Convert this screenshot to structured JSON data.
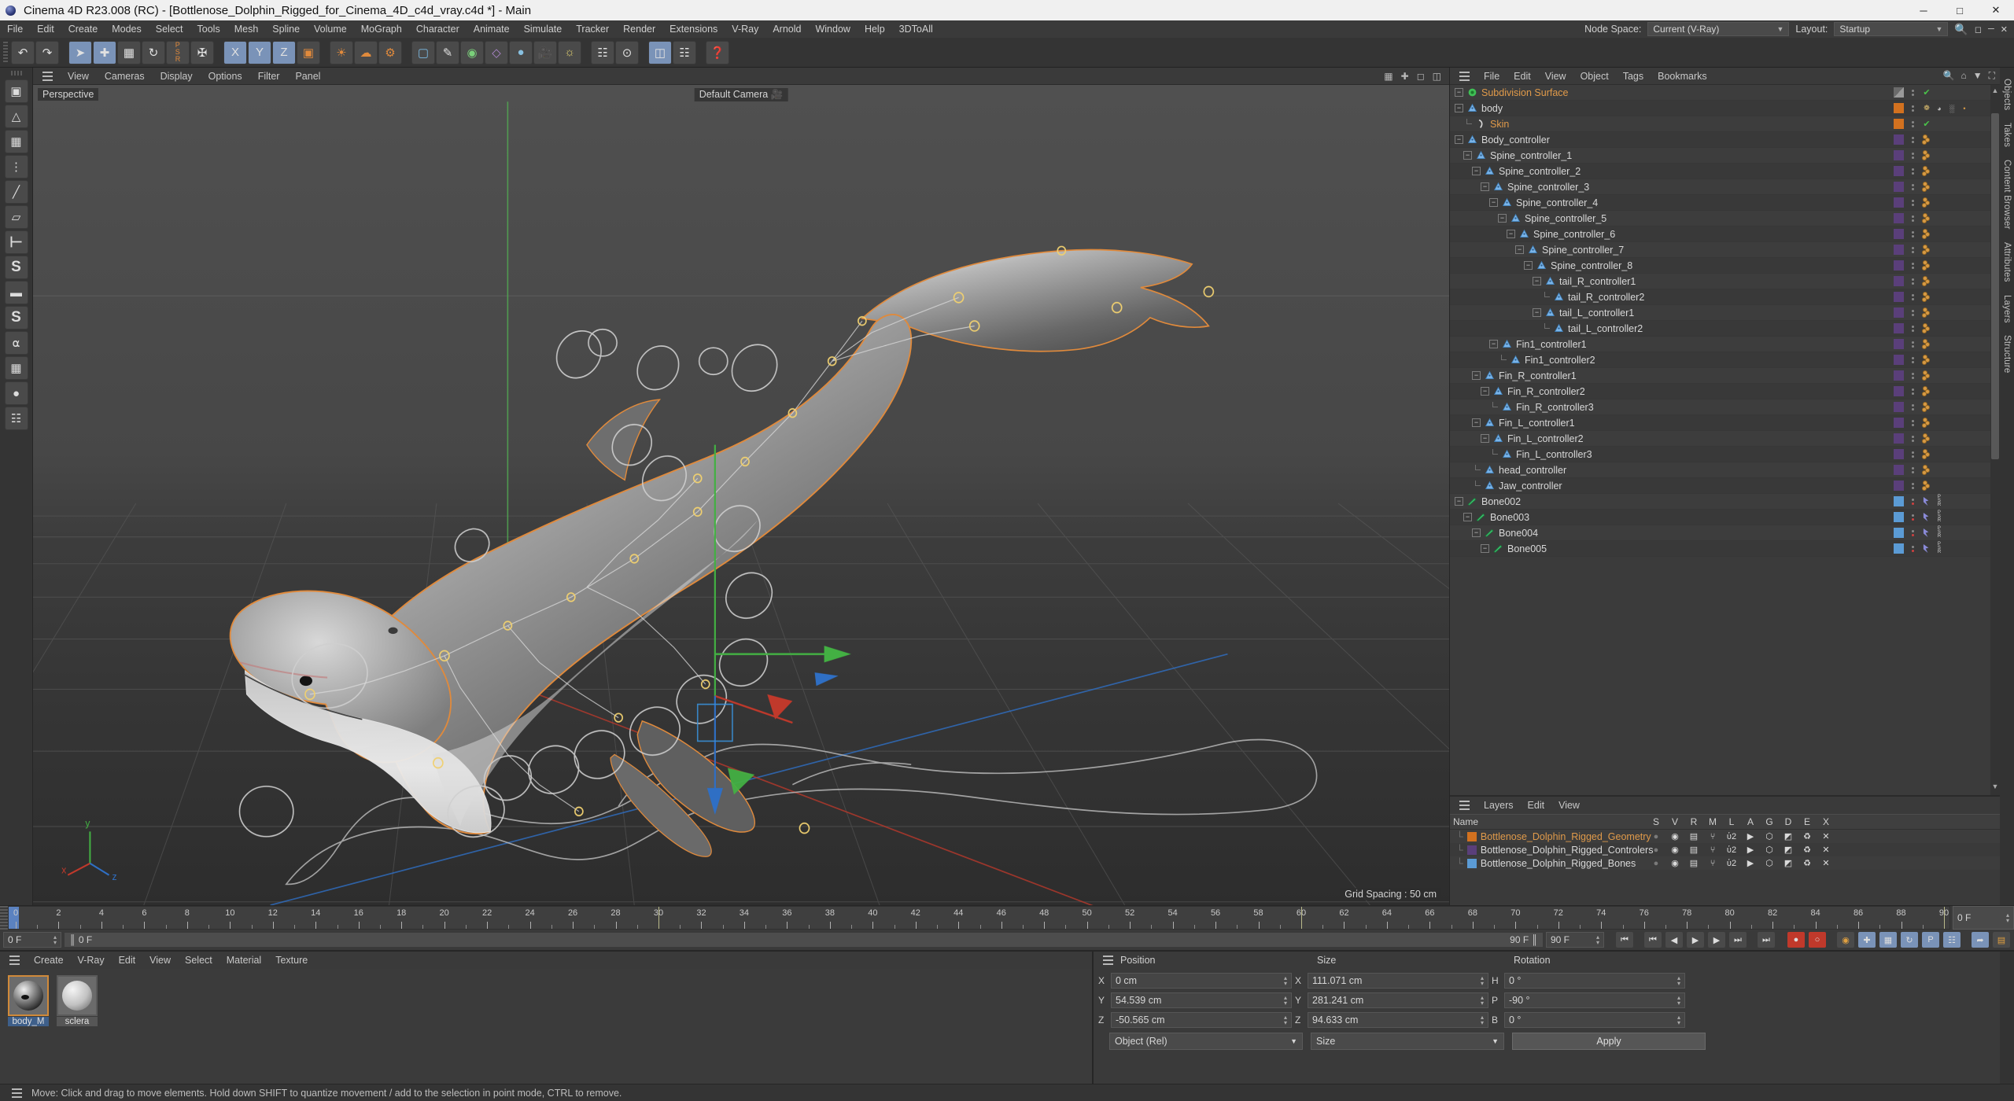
{
  "titlebar": {
    "title": "Cinema 4D R23.008 (RC) - [Bottlenose_Dolphin_Rigged_for_Cinema_4D_c4d_vray.c4d *] - Main",
    "minimize": "─",
    "maximize": "□",
    "close": "✕"
  },
  "menubar": {
    "items": [
      "File",
      "Edit",
      "Create",
      "Modes",
      "Select",
      "Tools",
      "Mesh",
      "Spline",
      "Volume",
      "MoGraph",
      "Character",
      "Animate",
      "Simulate",
      "Tracker",
      "Render",
      "Extensions",
      "V-Ray",
      "Arnold",
      "Window",
      "Help",
      "3DToAll"
    ],
    "node_space_label": "Node Space:",
    "node_space_value": "Current (V-Ray)",
    "layout_label": "Layout:",
    "layout_value": "Startup",
    "search_icon": "search-icon"
  },
  "viewport_menu": {
    "items": [
      "View",
      "Cameras",
      "Display",
      "Options",
      "Filter",
      "Panel"
    ],
    "right_icons": [
      "grid-icon",
      "axis-icon",
      "maximize-icon",
      "panel-icon"
    ]
  },
  "viewport": {
    "perspective_label": "Perspective",
    "camera_label": "Default Camera",
    "grid_spacing": "Grid Spacing : 50 cm",
    "axis_x": "x",
    "axis_y": "y",
    "axis_z": "z"
  },
  "object_manager": {
    "menu": [
      "File",
      "Edit",
      "View",
      "Object",
      "Tags",
      "Bookmarks"
    ],
    "rows": [
      {
        "label": "Subdivision Surface",
        "depth": 0,
        "icon": "subdivision-surface-icon",
        "color": "grey",
        "label_color": "orange",
        "tags": "check",
        "expander": "minus"
      },
      {
        "label": "body",
        "depth": 0,
        "icon": "polygon-object-icon",
        "color": "orange",
        "label_color": "white",
        "tags": "material",
        "expander": "minus"
      },
      {
        "label": "Skin",
        "depth": 1,
        "icon": "skin-deformer-icon",
        "color": "orange",
        "label_color": "orange",
        "tags": "check",
        "expander": "leaf"
      },
      {
        "label": "Body_controller",
        "depth": 0,
        "icon": "polygon-object-icon",
        "color": "purple",
        "label_color": "white",
        "tags": "ctag",
        "expander": "minus"
      },
      {
        "label": "Spine_controller_1",
        "depth": 1,
        "icon": "polygon-object-icon",
        "color": "purple",
        "label_color": "white",
        "tags": "ctag",
        "expander": "minus"
      },
      {
        "label": "Spine_controller_2",
        "depth": 2,
        "icon": "polygon-object-icon",
        "color": "purple",
        "label_color": "white",
        "tags": "ctag",
        "expander": "minus"
      },
      {
        "label": "Spine_controller_3",
        "depth": 3,
        "icon": "polygon-object-icon",
        "color": "purple",
        "label_color": "white",
        "tags": "ctag",
        "expander": "minus"
      },
      {
        "label": "Spine_controller_4",
        "depth": 4,
        "icon": "polygon-object-icon",
        "color": "purple",
        "label_color": "white",
        "tags": "ctag",
        "expander": "minus"
      },
      {
        "label": "Spine_controller_5",
        "depth": 5,
        "icon": "polygon-object-icon",
        "color": "purple",
        "label_color": "white",
        "tags": "ctag",
        "expander": "minus"
      },
      {
        "label": "Spine_controller_6",
        "depth": 6,
        "icon": "polygon-object-icon",
        "color": "purple",
        "label_color": "white",
        "tags": "ctag",
        "expander": "minus"
      },
      {
        "label": "Spine_controller_7",
        "depth": 7,
        "icon": "polygon-object-icon",
        "color": "purple",
        "label_color": "white",
        "tags": "ctag",
        "expander": "minus"
      },
      {
        "label": "Spine_controller_8",
        "depth": 8,
        "icon": "polygon-object-icon",
        "color": "purple",
        "label_color": "white",
        "tags": "ctag",
        "expander": "minus"
      },
      {
        "label": "tail_R_controller1",
        "depth": 9,
        "icon": "polygon-object-icon",
        "color": "purple",
        "label_color": "white",
        "tags": "ctag",
        "expander": "minus"
      },
      {
        "label": "tail_R_controller2",
        "depth": 10,
        "icon": "polygon-object-icon",
        "color": "purple",
        "label_color": "white",
        "tags": "ctag",
        "expander": "leaf"
      },
      {
        "label": "tail_L_controller1",
        "depth": 9,
        "icon": "polygon-object-icon",
        "color": "purple",
        "label_color": "white",
        "tags": "ctag",
        "expander": "minus"
      },
      {
        "label": "tail_L_controller2",
        "depth": 10,
        "icon": "polygon-object-icon",
        "color": "purple",
        "label_color": "white",
        "tags": "ctag",
        "expander": "leaf"
      },
      {
        "label": "Fin1_controller1",
        "depth": 4,
        "icon": "polygon-object-icon",
        "color": "purple",
        "label_color": "white",
        "tags": "ctag",
        "expander": "minus"
      },
      {
        "label": "Fin1_controller2",
        "depth": 5,
        "icon": "polygon-object-icon",
        "color": "purple",
        "label_color": "white",
        "tags": "ctag",
        "expander": "leaf"
      },
      {
        "label": "Fin_R_controller1",
        "depth": 2,
        "icon": "polygon-object-icon",
        "color": "purple",
        "label_color": "white",
        "tags": "ctag",
        "expander": "minus"
      },
      {
        "label": "Fin_R_controller2",
        "depth": 3,
        "icon": "polygon-object-icon",
        "color": "purple",
        "label_color": "white",
        "tags": "ctag",
        "expander": "minus"
      },
      {
        "label": "Fin_R_controller3",
        "depth": 4,
        "icon": "polygon-object-icon",
        "color": "purple",
        "label_color": "white",
        "tags": "ctag",
        "expander": "leaf"
      },
      {
        "label": "Fin_L_controller1",
        "depth": 2,
        "icon": "polygon-object-icon",
        "color": "purple",
        "label_color": "white",
        "tags": "ctag",
        "expander": "minus"
      },
      {
        "label": "Fin_L_controller2",
        "depth": 3,
        "icon": "polygon-object-icon",
        "color": "purple",
        "label_color": "white",
        "tags": "ctag",
        "expander": "minus"
      },
      {
        "label": "Fin_L_controller3",
        "depth": 4,
        "icon": "polygon-object-icon",
        "color": "purple",
        "label_color": "white",
        "tags": "ctag",
        "expander": "leaf"
      },
      {
        "label": "head_controller",
        "depth": 2,
        "icon": "polygon-object-icon",
        "color": "purple",
        "label_color": "white",
        "tags": "ctag",
        "expander": "leaf"
      },
      {
        "label": "Jaw_controller",
        "depth": 2,
        "icon": "polygon-object-icon",
        "color": "purple",
        "label_color": "white",
        "tags": "ctag",
        "expander": "leaf"
      },
      {
        "label": "Bone002",
        "depth": 0,
        "icon": "bone-icon",
        "color": "blue",
        "label_color": "white",
        "tags": "bone",
        "expander": "minus"
      },
      {
        "label": "Bone003",
        "depth": 1,
        "icon": "bone-icon",
        "color": "blue",
        "label_color": "white",
        "tags": "bone",
        "expander": "minus"
      },
      {
        "label": "Bone004",
        "depth": 2,
        "icon": "bone-icon",
        "color": "blue",
        "label_color": "white",
        "tags": "bone",
        "expander": "minus"
      },
      {
        "label": "Bone005",
        "depth": 3,
        "icon": "bone-icon",
        "color": "blue",
        "label_color": "white",
        "tags": "bone",
        "expander": "minus"
      }
    ]
  },
  "layers_panel": {
    "menu": [
      "Layers",
      "Edit",
      "View"
    ],
    "name_header": "Name",
    "columns": [
      "S",
      "V",
      "R",
      "M",
      "L",
      "A",
      "G",
      "D",
      "E",
      "X"
    ],
    "rows": [
      {
        "label": "Bottlenose_Dolphin_Rigged_Geometry",
        "color": "#d2711f",
        "label_color": "#e09a4a"
      },
      {
        "label": "Bottlenose_Dolphin_Rigged_Controlers",
        "color": "#5a3f7a",
        "label_color": "#d8d8d8"
      },
      {
        "label": "Bottlenose_Dolphin_Rigged_Bones",
        "color": "#5b9bd5",
        "label_color": "#d8d8d8"
      }
    ]
  },
  "right_tabs": [
    "Objects",
    "Takes",
    "Content Browser",
    "Attributes",
    "Layers",
    "Structure"
  ],
  "timeline": {
    "ticks": [
      0,
      2,
      4,
      6,
      8,
      10,
      12,
      14,
      16,
      18,
      20,
      22,
      24,
      26,
      28,
      30,
      32,
      34,
      36,
      38,
      40,
      42,
      44,
      46,
      48,
      50,
      52,
      54,
      56,
      58,
      60,
      62,
      64,
      66,
      68,
      70,
      72,
      74,
      76,
      78,
      80,
      82,
      84,
      86,
      88,
      90
    ],
    "current_frame": "0 F",
    "start_field": "0 F",
    "bar_left_value": "0 F",
    "bar_right_value": "90 F",
    "end_field": "90 F",
    "range_end": "90 F",
    "transport": [
      "go-to-start-icon",
      "previous-key-icon",
      "previous-frame-icon",
      "play-icon",
      "next-frame-icon",
      "next-key-icon",
      "go-to-end-icon"
    ],
    "record_buttons": [
      "record-icon",
      "autokey-icon"
    ],
    "key_mode_buttons": [
      "position-key-icon",
      "scale-key-icon",
      "rotation-key-icon",
      "param-key-icon",
      "pla-key-icon"
    ],
    "right_buttons": [
      "snap-icon",
      "timeline-icon",
      "dope-icon"
    ]
  },
  "material_manager": {
    "menu": [
      "Create",
      "V-Ray",
      "Edit",
      "View",
      "Select",
      "Material",
      "Texture"
    ],
    "materials": [
      {
        "name": "body_M",
        "selected": true
      },
      {
        "name": "sclera",
        "selected": false
      }
    ]
  },
  "coordinates": {
    "headers": {
      "position": "Position",
      "size": "Size",
      "rotation": "Rotation"
    },
    "position": {
      "x_label": "X",
      "x": "0 cm",
      "y_label": "Y",
      "y": "54.539 cm",
      "z_label": "Z",
      "z": "-50.565 cm"
    },
    "size": {
      "x_label": "X",
      "x": "111.071 cm",
      "y_label": "Y",
      "y": "281.241 cm",
      "z_label": "Z",
      "z": "94.633 cm"
    },
    "rotation": {
      "h_label": "H",
      "h": "0 °",
      "p_label": "P",
      "p": "-90 °",
      "b_label": "B",
      "b": "0 °"
    },
    "coord_system": "Object (Rel)",
    "size_mode": "Size",
    "apply_label": "Apply"
  },
  "statusbar": {
    "text": "Move: Click and drag to move elements. Hold down SHIFT to quantize movement / add to the selection in point mode, CTRL to remove."
  },
  "colors": {
    "accent_orange": "#d2711f",
    "accent_purple": "#5a3f7a",
    "accent_blue": "#5b9bd5",
    "selection_blue": "#7a93b8",
    "panel_bg": "#3a3a3a",
    "viewport_bg": "#4a4a4a"
  }
}
